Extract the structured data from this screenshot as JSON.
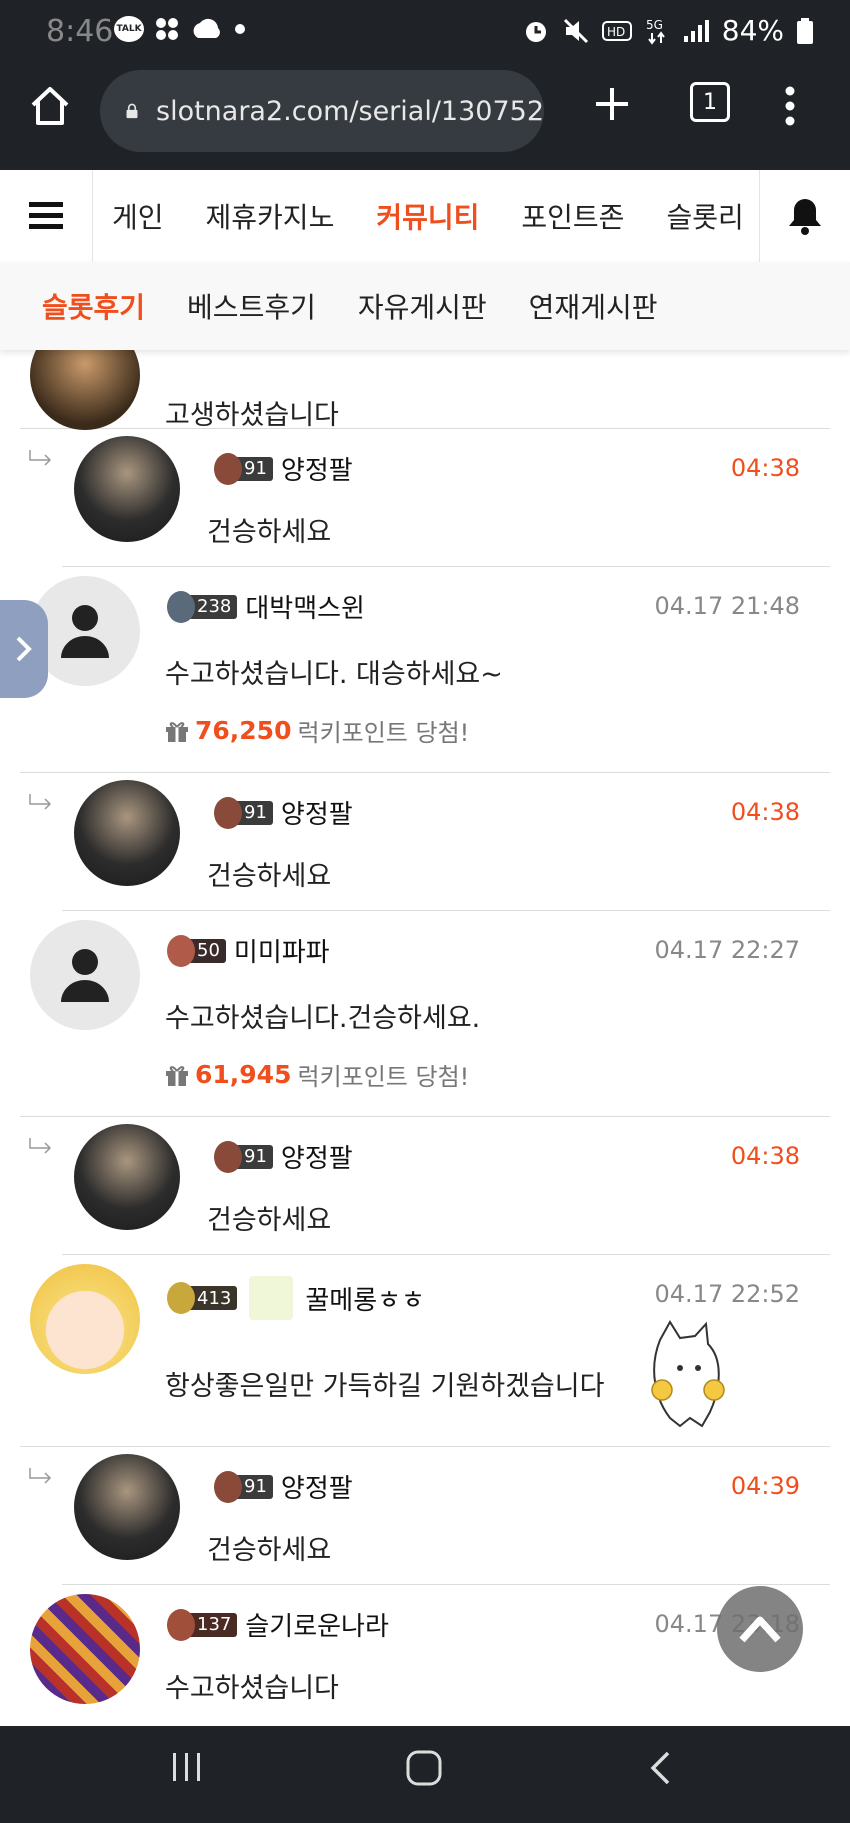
{
  "status": {
    "time": "8:46",
    "talk": "TALK",
    "battery": "84%"
  },
  "browser": {
    "url": "slotnara2.com/serial/130752",
    "tabs": "1"
  },
  "nav": {
    "items": [
      "게인",
      "제휴카지노",
      "커뮤니티",
      "포인트존",
      "슬롯리"
    ]
  },
  "subnav": {
    "items": [
      "슬롯후기",
      "베스트후기",
      "자유게시판",
      "연재게시판"
    ]
  },
  "comments": [
    {
      "text": "고생하셨습니다"
    },
    {
      "level": "91",
      "name": "양정팔",
      "time": "04:38",
      "text": "건승하세요"
    },
    {
      "level": "238",
      "name": "대박맥스윈",
      "time": "04.17 21:48",
      "text": "수고하셨습니다. 대승하세요~",
      "points": "76,250",
      "points_label": "럭키포인트 당첨!"
    },
    {
      "level": "91",
      "name": "양정팔",
      "time": "04:38",
      "text": "건승하세요"
    },
    {
      "level": "50",
      "name": "미미파파",
      "time": "04.17 22:27",
      "text": "수고하셨습니다.건승하세요.",
      "points": "61,945",
      "points_label": "럭키포인트 당첨!"
    },
    {
      "level": "91",
      "name": "양정팔",
      "time": "04:38",
      "text": "건승하세요"
    },
    {
      "level": "413",
      "name": "꿀메롱ㅎㅎ",
      "time": "04.17 22:52",
      "text": "항상좋은일만 가득하길 기원하겠습니다"
    },
    {
      "level": "91",
      "name": "양정팔",
      "time": "04:39",
      "text": "건승하세요"
    },
    {
      "level": "137",
      "name": "슬기로운나라",
      "time": "04.17 23:18",
      "text": "수고하셨습니다"
    }
  ]
}
